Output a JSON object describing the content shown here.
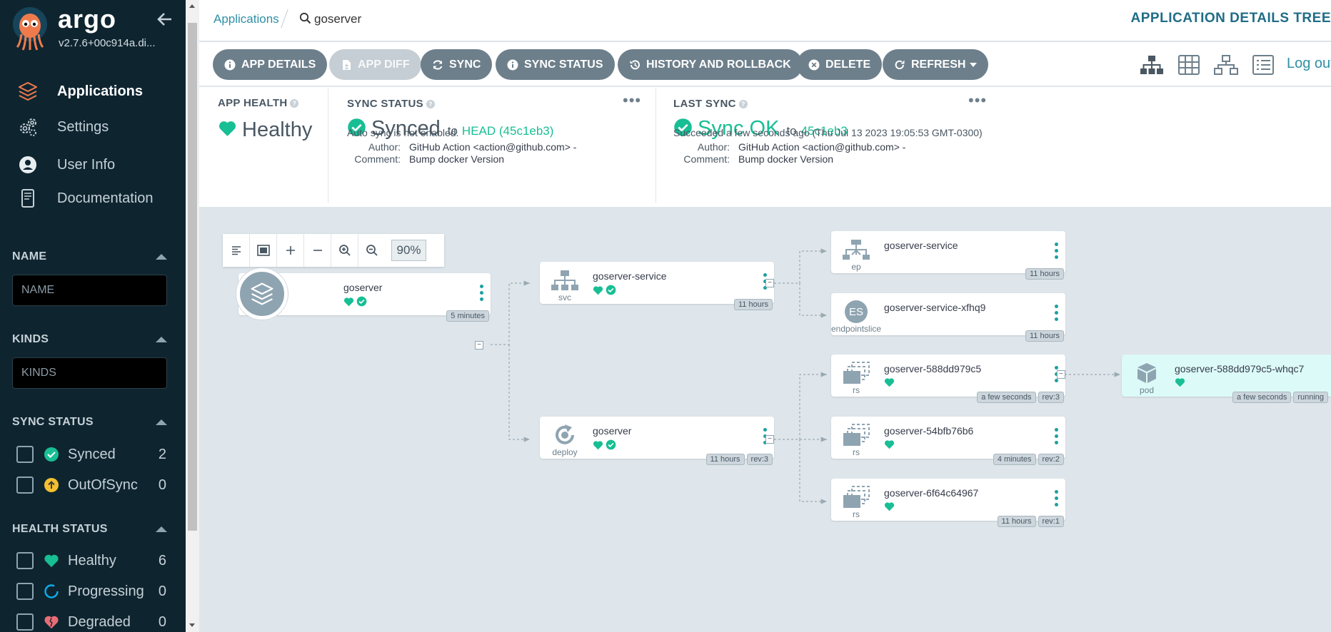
{
  "app": {
    "name": "argo",
    "version": "v2.7.6+00c914a.di..."
  },
  "nav": [
    {
      "label": "Applications",
      "icon": "layers-icon"
    },
    {
      "label": "Settings",
      "icon": "gears-icon"
    },
    {
      "label": "User Info",
      "icon": "user-icon"
    },
    {
      "label": "Documentation",
      "icon": "book-icon"
    }
  ],
  "filters": {
    "name": {
      "title": "NAME",
      "placeholder": "NAME"
    },
    "kinds": {
      "title": "KINDS",
      "placeholder": "KINDS"
    },
    "sync_status": {
      "title": "SYNC STATUS",
      "items": [
        {
          "label": "Synced",
          "count": "2"
        },
        {
          "label": "OutOfSync",
          "count": "0"
        }
      ]
    },
    "health_status": {
      "title": "HEALTH STATUS",
      "items": [
        {
          "label": "Healthy",
          "count": "6"
        },
        {
          "label": "Progressing",
          "count": "0"
        },
        {
          "label": "Degraded",
          "count": "0"
        }
      ]
    }
  },
  "breadcrumb": {
    "root": "Applications",
    "current": "goserver"
  },
  "page_title": "APPLICATION DETAILS TREE",
  "toolbar": {
    "app_details": "APP DETAILS",
    "app_diff": "APP DIFF",
    "sync": "SYNC",
    "sync_status": "SYNC STATUS",
    "history": "HISTORY AND ROLLBACK",
    "delete": "DELETE",
    "refresh": "REFRESH",
    "logout": "Log out"
  },
  "status": {
    "app_health": {
      "title": "APP HEALTH",
      "value": "Healthy"
    },
    "sync": {
      "title": "SYNC STATUS",
      "value": "Synced",
      "to": "to",
      "revision": "HEAD (45c1eb3)",
      "note": "Auto sync is not enabled.",
      "author_label": "Author:",
      "author": "GitHub Action <action@github.com> -",
      "comment_label": "Comment:",
      "comment": "Bump docker Version"
    },
    "last_sync": {
      "title": "LAST SYNC",
      "value": "Sync OK",
      "to": "to",
      "revision": "45c1eb3",
      "note": "Succeeded a few seconds ago (Thu Jul 13 2023 19:05:53 GMT-0300)",
      "author_label": "Author:",
      "author": "GitHub Action <action@github.com> -",
      "comment_label": "Comment:",
      "comment": "Bump docker Version"
    }
  },
  "graph": {
    "zoom": "90%",
    "nodes": {
      "app": {
        "name": "goserver",
        "tags": [
          "5 minutes"
        ]
      },
      "svc": {
        "name": "goserver-service",
        "kind": "svc",
        "tags": [
          "11 hours"
        ]
      },
      "deploy": {
        "name": "goserver",
        "kind": "deploy",
        "tags": [
          "11 hours",
          "rev:3"
        ]
      },
      "ep": {
        "name": "goserver-service",
        "kind": "ep",
        "tags": [
          "11 hours"
        ]
      },
      "es": {
        "name": "goserver-service-xfhq9",
        "kind": "endpointslice",
        "badge": "ES",
        "tags": [
          "11 hours"
        ]
      },
      "rs1": {
        "name": "goserver-588dd979c5",
        "kind": "rs",
        "tags": [
          "a few seconds",
          "rev:3"
        ]
      },
      "rs2": {
        "name": "goserver-54bfb76b6",
        "kind": "rs",
        "tags": [
          "4 minutes",
          "rev:2"
        ]
      },
      "rs3": {
        "name": "goserver-6f64c64967",
        "kind": "rs",
        "tags": [
          "11 hours",
          "rev:1"
        ]
      },
      "pod": {
        "name": "goserver-588dd979c5-whqc7",
        "kind": "pod",
        "tags": [
          "a few seconds",
          "running"
        ]
      }
    }
  },
  "colors": {
    "healthy": "#18be94",
    "synced": "#18be94",
    "outofsync": "#f4c030",
    "progressing": "#0dadea",
    "degraded": "#e96d76",
    "link": "#2f8fa5"
  }
}
